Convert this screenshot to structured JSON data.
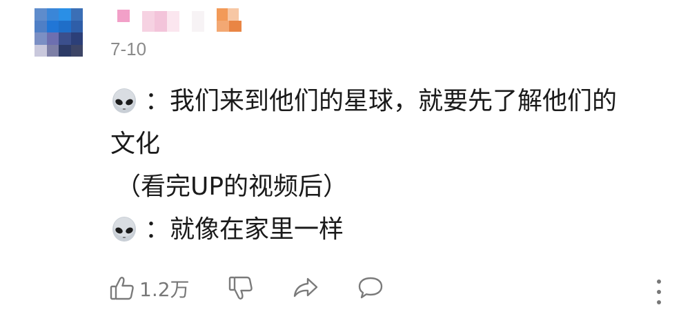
{
  "comment": {
    "date": "7-10",
    "lines": [
      {
        "prefix_icon": "alien-icon",
        "text": "：我们来到他们的星球，就要先了解他们的"
      },
      {
        "text": "文化"
      },
      {
        "text": "（看完UP的视频后）"
      },
      {
        "prefix_icon": "alien-icon",
        "text": "：就像在家里一样"
      }
    ],
    "like_count": "1.2万"
  },
  "icons": {
    "like": "thumbs-up-icon",
    "dislike": "thumbs-down-icon",
    "share": "share-icon",
    "reply": "comment-icon",
    "more": "more-vertical-icon"
  },
  "colors": {
    "text": "#1a1a1a",
    "meta": "#8a8a8a",
    "icon": "#7a7a7a"
  }
}
